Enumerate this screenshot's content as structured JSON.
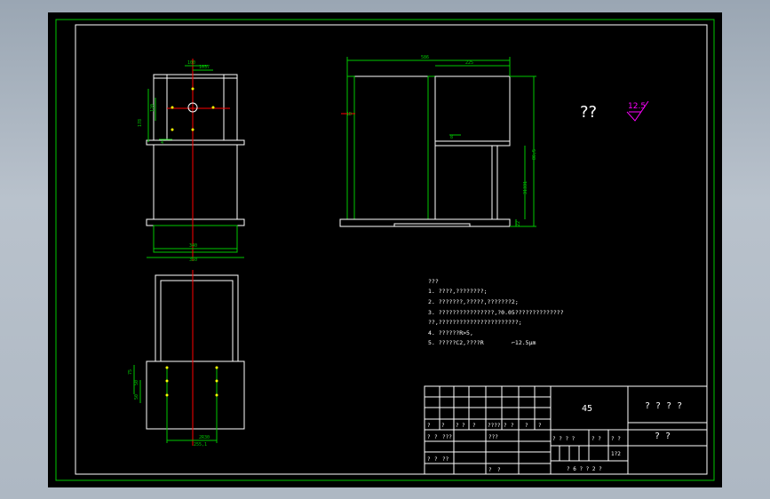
{
  "sheet": {
    "background": "#000000",
    "frame_color": "#00c800",
    "line_color": "#ffffff",
    "center_line_color": "#ff0000",
    "hole_color": "#ffff00",
    "symbol_color": "#ff00ff"
  },
  "front_view": {
    "dims": {
      "top1": "100",
      "top2": "1037",
      "left1": "178",
      "left2": "120",
      "small": "4",
      "bottom1": "340",
      "bottom2": "350"
    }
  },
  "side_view": {
    "dims": {
      "top1": "586",
      "top2": "225",
      "right1": "86,5",
      "right2": "31331",
      "right3": "22",
      "bracket": "8",
      "left": "1D"
    }
  },
  "plan_view": {
    "dims": {
      "left1": "75",
      "left2": "50",
      "left3": "50",
      "bottom1": "2R30",
      "bottom2": "255,1"
    }
  },
  "roughness": {
    "marks": "??",
    "value": "12.5"
  },
  "notes": {
    "title": "???",
    "lines": [
      "1. ????,????????;",
      "2. ???????,?????,???????2;",
      "3. ????????????????,?0.05??????????????",
      "??,???????????????????????;",
      "4. ??????R>5,",
      "5. ?????C2,????R",
      "⌐12.5μm"
    ]
  },
  "title_block": {
    "material": "45",
    "drawing_name": "? ? ? ?",
    "company": "? ?",
    "cells": {
      "row_a": [
        "?",
        "?",
        "?",
        "?",
        "?",
        "????",
        "?",
        "?",
        "?",
        "?"
      ],
      "row_b": [
        "?",
        "?",
        "???",
        "???"
      ],
      "row_c_left": [
        "?",
        "?",
        "??"
      ],
      "row_c_right": [
        "?",
        "?"
      ],
      "phase": "? ? ? ?",
      "weight": "? ?",
      "scale_label": "? ?",
      "scale": "1?2",
      "sheet": "? 6 ? ? 2 ?"
    }
  }
}
